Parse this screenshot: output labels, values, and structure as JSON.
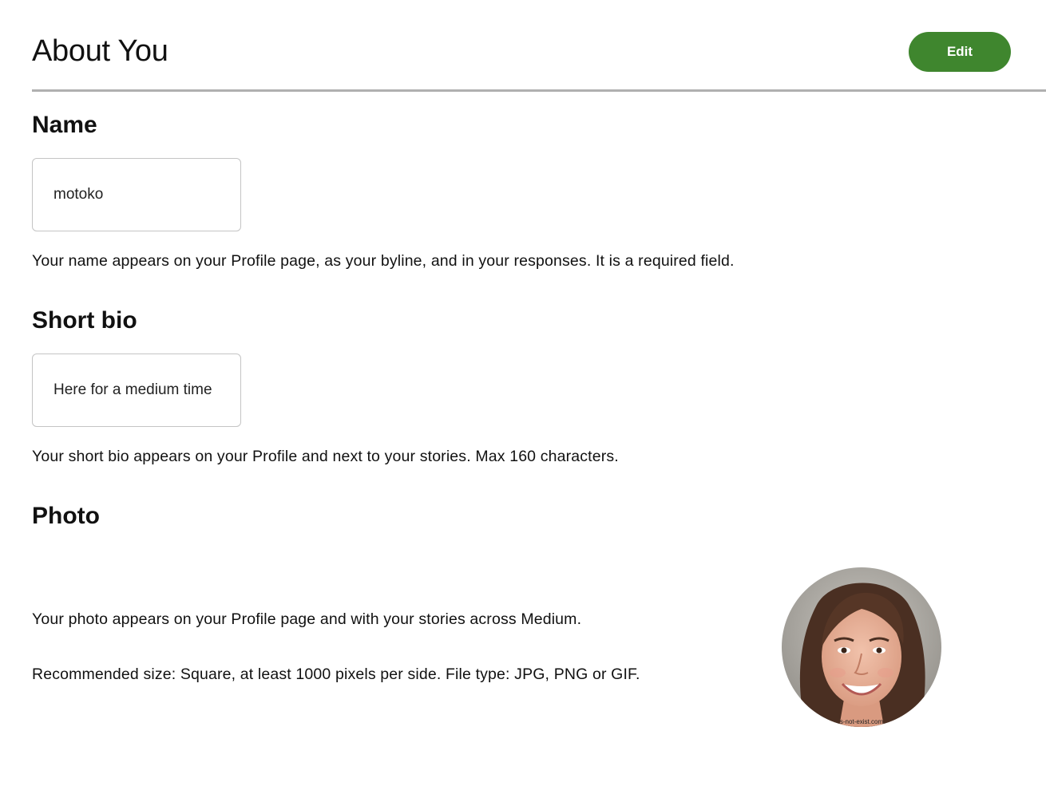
{
  "header": {
    "title": "About You",
    "edit_label": "Edit"
  },
  "name_section": {
    "title": "Name",
    "value": "motoko",
    "help": "Your name appears on your Profile page, as your byline, and in your responses. It is a required field."
  },
  "bio_section": {
    "title": "Short bio",
    "value": "Here for a medium time",
    "help": "Your short bio appears on your Profile and next to your stories. Max 160 characters."
  },
  "photo_section": {
    "title": "Photo",
    "help": "Your photo appears on your Profile page and with your stories across Medium.",
    "recommendation": "Recommended size: Square, at least 1000 pixels per side. File type: JPG, PNG or GIF.",
    "watermark": "s-not-exist.com"
  },
  "colors": {
    "accent": "#3f862e",
    "divider": "#b0b0b0",
    "field_border": "#c4c4c4"
  }
}
